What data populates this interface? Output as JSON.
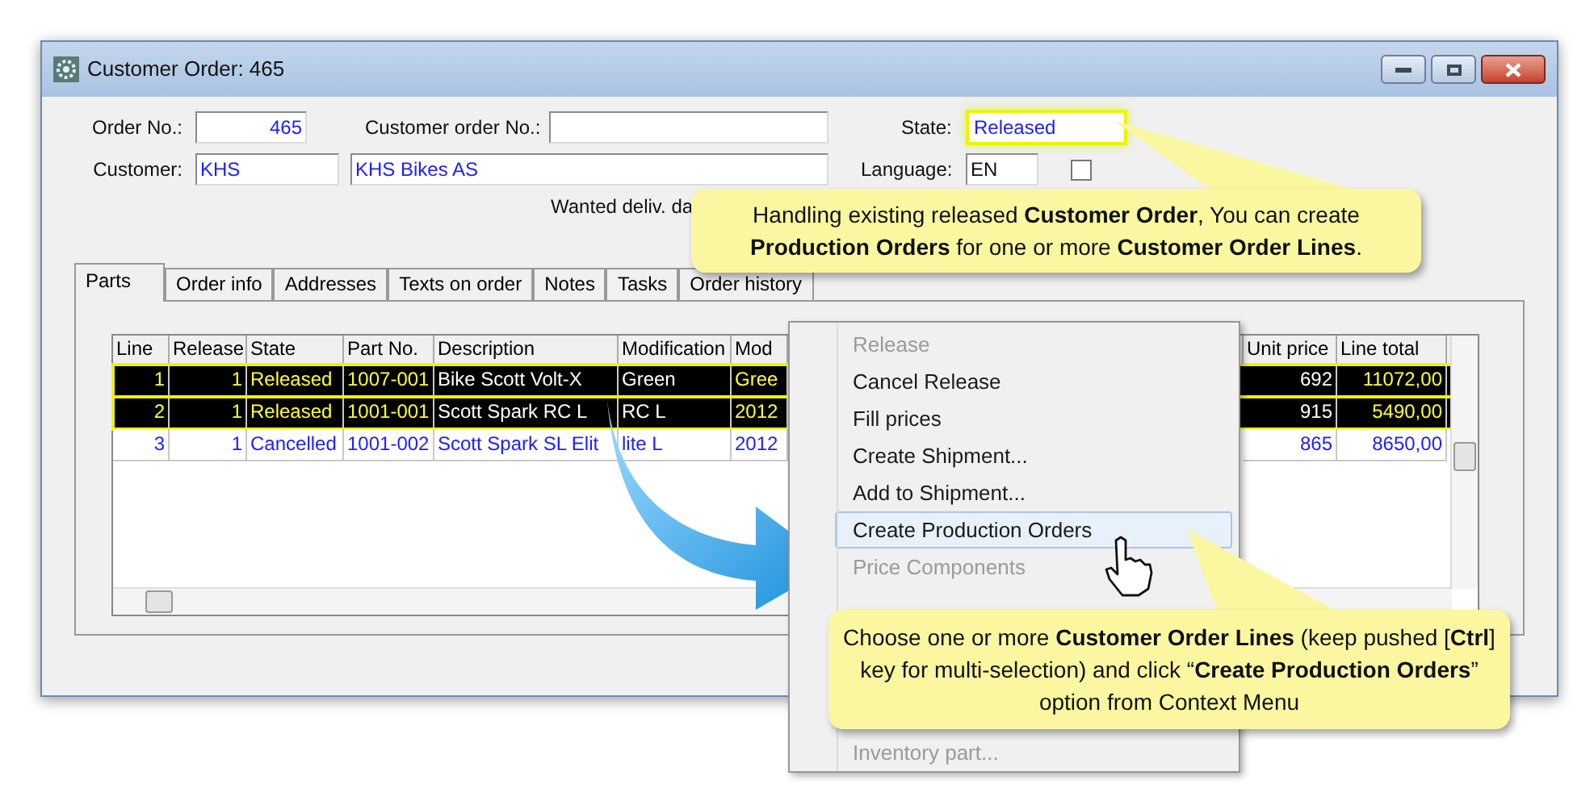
{
  "window": {
    "title": "Customer Order: 465"
  },
  "form": {
    "order_no": {
      "label": "Order No.:",
      "value": "465"
    },
    "customer_order_no": {
      "label": "Customer order No.:"
    },
    "state": {
      "label": "State:",
      "value": "Released",
      "highlighted": true
    },
    "customer": {
      "label": "Customer:",
      "code": "KHS",
      "name": "KHS Bikes AS"
    },
    "language": {
      "label": "Language:",
      "value": "EN"
    },
    "hide_closed": {
      "checked": false
    },
    "wanted_delivery": {
      "label": "Wanted deliv. da"
    }
  },
  "tabs": [
    {
      "label": "Parts",
      "selected": true
    },
    {
      "label": "Order info",
      "selected": false
    },
    {
      "label": "Addresses",
      "selected": false
    },
    {
      "label": "Texts on order",
      "selected": false
    },
    {
      "label": "Notes",
      "selected": false
    },
    {
      "label": "Tasks",
      "selected": false
    },
    {
      "label": "Order history",
      "selected": false
    }
  ],
  "table": {
    "columns": [
      "Line",
      "Release",
      "State",
      "Part No.",
      "Description",
      "Modification",
      "Mod",
      "Unit price",
      "Line total"
    ],
    "rows": [
      {
        "selected": true,
        "cells": [
          "1",
          "1",
          "Released",
          "1007-001",
          "Bike Scott Volt-X",
          "Green",
          "Gree",
          "692",
          "11072,00"
        ]
      },
      {
        "selected": true,
        "cells": [
          "2",
          "1",
          "Released",
          "1001-001",
          "Scott Spark RC L",
          "RC L",
          "2012",
          "915",
          "5490,00"
        ]
      },
      {
        "selected": false,
        "cells": [
          "3",
          "1",
          "Cancelled",
          "1001-002",
          "Scott Spark SL Elit",
          "lite L",
          "2012",
          "865",
          "8650,00"
        ]
      }
    ]
  },
  "context_menu": {
    "items": [
      {
        "label": "Release",
        "disabled": true,
        "selected": false
      },
      {
        "label": "Cancel Release",
        "disabled": false,
        "selected": false
      },
      {
        "label": "Fill prices",
        "disabled": false,
        "selected": false
      },
      {
        "label": "Create Shipment...",
        "disabled": false,
        "selected": false
      },
      {
        "label": "Add to Shipment...",
        "disabled": false,
        "selected": false
      },
      {
        "label": "Create Production Orders",
        "disabled": false,
        "selected": true
      },
      {
        "label": "Price Components",
        "disabled": true,
        "selected": false
      }
    ],
    "bottom_items": [
      {
        "label": "Inventory part...",
        "disabled": true,
        "selected": false
      }
    ]
  },
  "callouts": [
    {
      "text": "Handling existing released **Customer Order**, You can create **Production  Orders** for one or more **Customer Order Lines**."
    },
    {
      "text": "Choose one or more **Customer Order Lines** (keep pushed [**Ctrl**] key for multi-selection) and click “**Create Production  Orders**” option from Context Menu"
    }
  ]
}
